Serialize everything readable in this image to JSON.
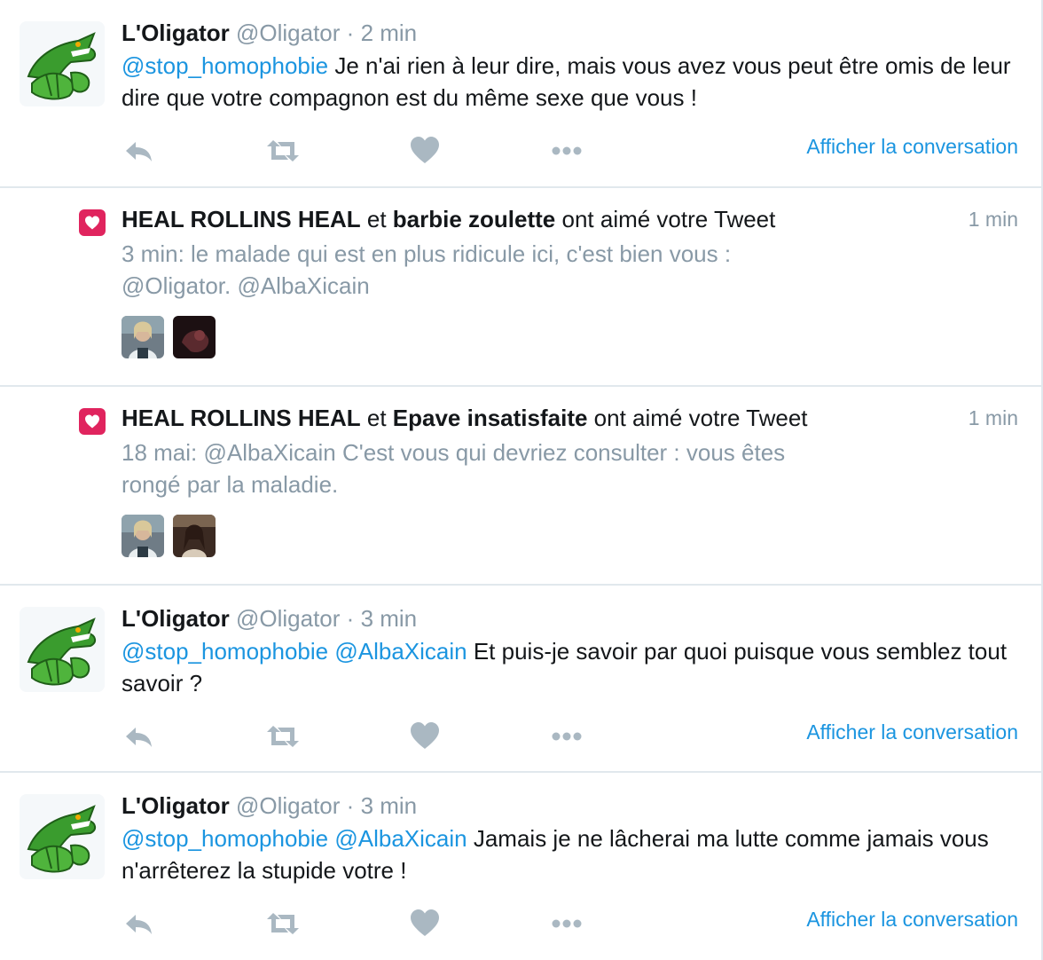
{
  "tweets": [
    {
      "fullname": "L'Oligator",
      "handle": "@Oligator",
      "dot": "·",
      "time": "2 min",
      "mention1": "@stop_homophobie",
      "text": " Je n'ai rien à leur dire, mais vous avez vous peut être omis de leur dire que votre compagnon est du même sexe que vous !",
      "show_conversation": "Afficher la conversation"
    },
    {
      "fullname": "L'Oligator",
      "handle": "@Oligator",
      "dot": "·",
      "time": "3 min",
      "mention1": "@stop_homophobie",
      "mention2": "@AlbaXicain",
      "text": " Et puis-je savoir par quoi puisque vous semblez tout savoir ?",
      "show_conversation": "Afficher la conversation"
    },
    {
      "fullname": "L'Oligator",
      "handle": "@Oligator",
      "dot": "·",
      "time": "3 min",
      "mention1": "@stop_homophobie",
      "mention2": "@AlbaXicain",
      "text": " Jamais je ne lâcherai ma lutte comme jamais vous n'arrêterez la stupide votre !",
      "show_conversation": "Afficher la conversation"
    }
  ],
  "notifications": [
    {
      "user1": "HEAL ROLLINS HEAL",
      "and": " et ",
      "user2": "barbie zoulette",
      "action": " ont aimé votre Tweet",
      "time": "1 min",
      "quote_line1": "3 min: le malade qui est en plus ridicule ici, c'est bien vous :",
      "quote_line2": "@Oligator. @AlbaXicain"
    },
    {
      "user1": "HEAL ROLLINS HEAL",
      "and": " et ",
      "user2": "Epave insatisfaite",
      "action": " ont aimé votre Tweet",
      "time": "1 min",
      "quote_line1": "18 mai: @AlbaXicain C'est vous qui devriez consulter : vous êtes",
      "quote_line2": "rongé par la maladie."
    }
  ],
  "colors": {
    "link": "#1b95e0",
    "muted": "#8899a6",
    "action_icon": "#aab8c2",
    "like_badge": "#e0245e",
    "divider": "#e1e8ed"
  },
  "icons": [
    "reply-icon",
    "retweet-icon",
    "like-icon",
    "more-icon",
    "heart-icon",
    "crocodile-avatar"
  ]
}
